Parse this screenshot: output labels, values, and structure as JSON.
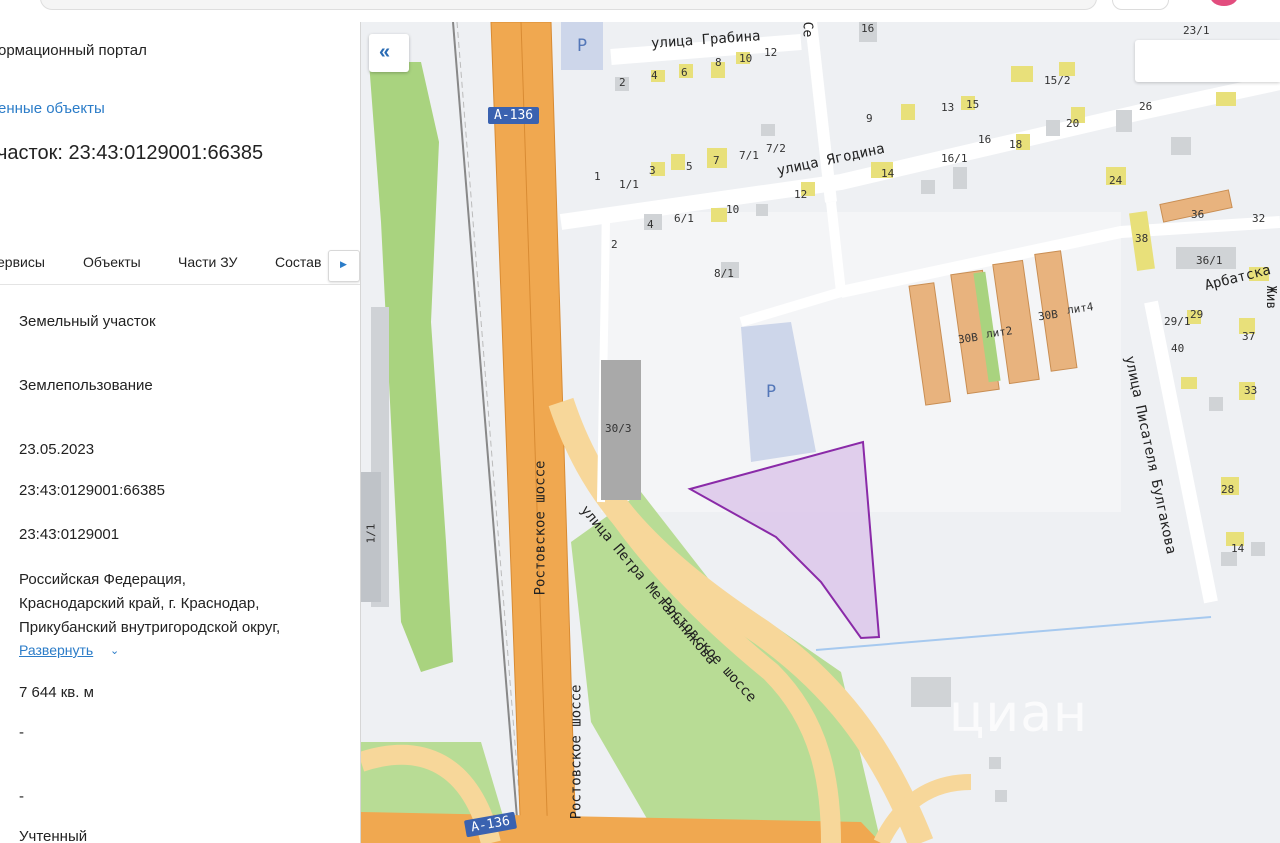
{
  "panel": {
    "portal_title": "ормационный портал",
    "found_link": "енные объекты",
    "parcel_title": "часток: 23:43:0129001:66385",
    "tabs": [
      "ервисы",
      "Объекты",
      "Части ЗУ",
      "Состав"
    ],
    "rows": [
      "Земельный участок",
      "Землепользование",
      "23.05.2023",
      "23:43:0129001:66385",
      "23:43:0129001"
    ],
    "address_lines": [
      "Российская Федерация,",
      "Краснодарский край, г. Краснодар,",
      "Прикубанский внутригородской округ,"
    ],
    "expand_label": "Развернуть",
    "area": "7 644 кв. м",
    "dash1": "-",
    "dash2": "-",
    "status": "Учтенный"
  },
  "map": {
    "streets": {
      "grabina": "улица Грабина",
      "yagodina": "улица Ягодина",
      "arbatskaya": "Арбатска",
      "pisatelya": "улица Писателя Булгакова",
      "rostovskoe1": "Ростовское шоссе",
      "rostovskoe2": "Ростовское шоссе",
      "metalnikova": "улица Петра Метальникова",
      "rostovskoe3": "Ростовское шоссе",
      "sc": "Се",
      "zhiv": "Жив"
    },
    "road_shields": [
      "А-136",
      "А-136"
    ],
    "parking": [
      "P",
      "P"
    ],
    "house_numbers": [
      "2",
      "4",
      "6",
      "8",
      "10",
      "12",
      "1",
      "1/1",
      "3",
      "5",
      "7",
      "7/1",
      "7/2",
      "4",
      "6/1",
      "10",
      "12",
      "2",
      "8/1",
      "30/3",
      "9",
      "13",
      "15",
      "15/2",
      "16",
      "23/1",
      "26",
      "20",
      "16/1",
      "16",
      "18",
      "14",
      "24",
      "36",
      "32",
      "38",
      "36/1",
      "29/1",
      "29",
      "40",
      "37",
      "33",
      "28",
      "14",
      "30В",
      "лит2",
      "30В",
      "лит4",
      "1/1"
    ],
    "watermark": "циан",
    "colors": {
      "highway": "#f0a850",
      "road": "#f7d79a",
      "green": "#a9d37f",
      "parcel_fill": "#dcc7ea",
      "parcel_stroke": "#8a2aa8",
      "building": "#e8e07a",
      "building_orange": "#e8b37e"
    }
  }
}
